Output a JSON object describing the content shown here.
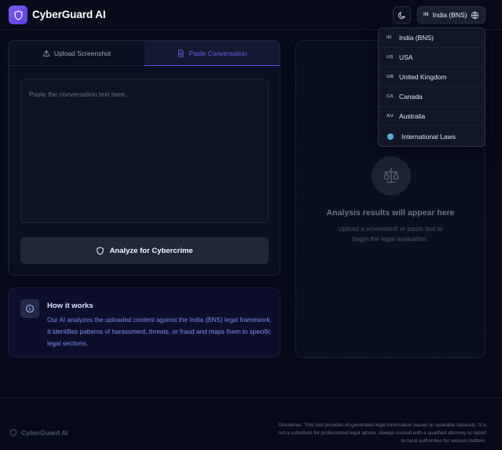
{
  "header": {
    "title": "CyberGuard AI",
    "logo_icon": "shield-icon",
    "theme_icon": "moon-icon",
    "region": {
      "code": "IN",
      "label": "India (BNS)",
      "icon": "globe-icon"
    }
  },
  "tabs": [
    {
      "label": "Upload Screenshot",
      "icon": "upload-icon",
      "active": false
    },
    {
      "label": "Paste Conversation",
      "icon": "document-icon",
      "active": true
    }
  ],
  "input": {
    "placeholder": "Paste the conversation text here..."
  },
  "analyze_button": {
    "label": "Analyze for Cybercrime",
    "icon": "shield-icon"
  },
  "how_it_works": {
    "title": "How it works",
    "text": "Our AI analyzes the uploaded content against the India (BNS) legal framework. It identifies patterns of harassment, threats, or fraud and maps them to specific legal sections."
  },
  "results": {
    "icon": "scale-icon",
    "title": "Analysis results will appear here",
    "subtitle": "Upload a screenshot or paste text to begin the legal evaluation."
  },
  "region_menu": {
    "items": [
      {
        "code": "IN",
        "label": "India (BNS)"
      },
      {
        "code": "US",
        "label": "USA"
      },
      {
        "code": "GB",
        "label": "United Kingdom"
      },
      {
        "code": "CA",
        "label": "Canada"
      },
      {
        "code": "AU",
        "label": "Australia"
      },
      {
        "code": "",
        "label": "International Laws",
        "icon": "globe-icon"
      }
    ]
  },
  "footer": {
    "brand": "CyberGuard AI",
    "disclaimer": "Disclaimer: This tool provides AI-generated legal information based on available datasets. It is not a substitute for professional legal advice. Always consult with a qualified attorney or report to local authorities for serious matters."
  },
  "colors": {
    "accent": "#6d5ef5",
    "background": "#070b18",
    "card": "#0b1020"
  }
}
